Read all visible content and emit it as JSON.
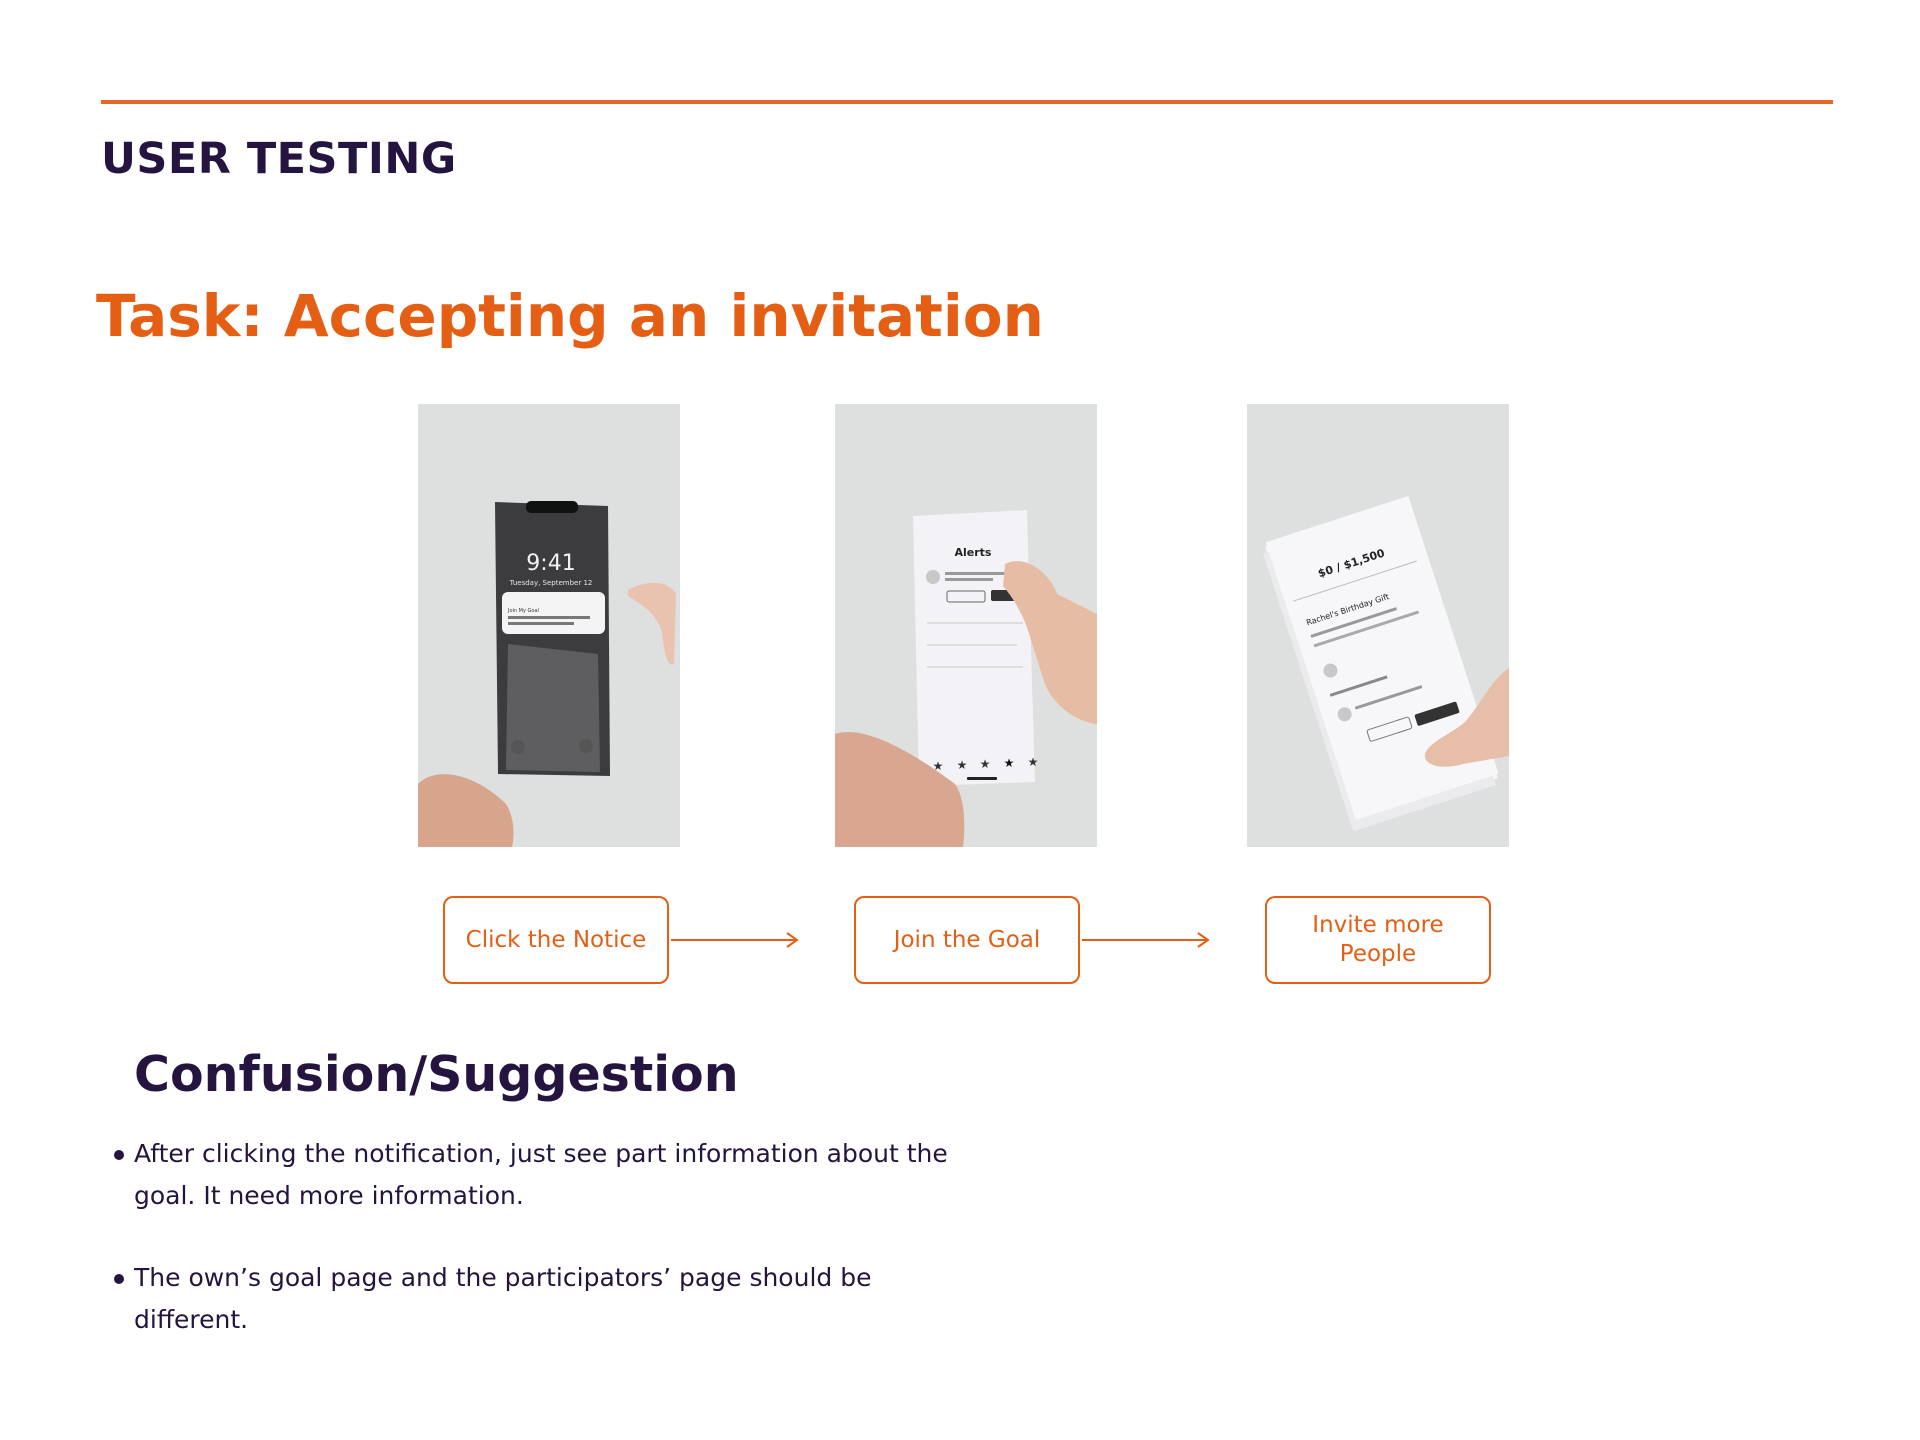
{
  "header": {
    "section_title": "USER TESTING"
  },
  "task": {
    "title": "Task: Accepting an invitation"
  },
  "photos": [
    {
      "screen_time": "9:41",
      "screen_date": "Tuesday, September 12",
      "notice_title": "Join My Goal"
    },
    {
      "screen_heading": "Alerts"
    },
    {
      "amount": "$0 / $1,500",
      "goal_name": "Rachel's Birthday Gift"
    }
  ],
  "steps": [
    {
      "label": "Click the Notice"
    },
    {
      "label": "Join the Goal"
    },
    {
      "label_line1": "Invite more",
      "label_line2": "People"
    }
  ],
  "confusion": {
    "title": "Confusion/Suggestion",
    "bullets": [
      {
        "line1": "After clicking the notification, just see part information about the",
        "line2": "goal. It need more information."
      },
      {
        "line1": "The own’s goal page and the participators’ page should be different."
      }
    ]
  },
  "colors": {
    "accent": "#e45e14",
    "rule": "#e8662a",
    "heading": "#24143f"
  }
}
